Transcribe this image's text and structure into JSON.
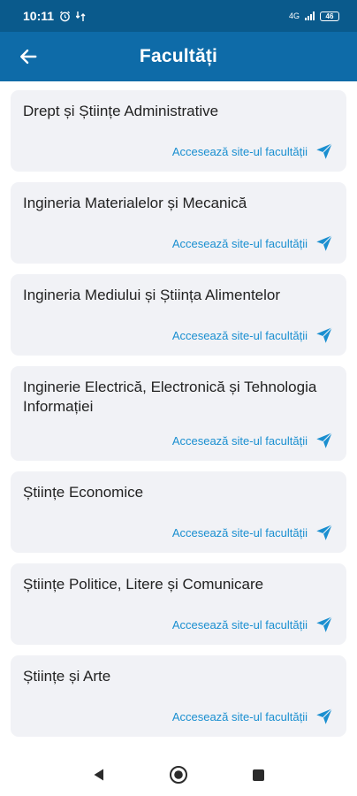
{
  "status_bar": {
    "time": "10:11",
    "network": "4G",
    "battery": "46"
  },
  "app_bar": {
    "title": "Facultăți"
  },
  "faculties": [
    {
      "name": "Drept și Științe Administrative",
      "link_label": "Accesează site-ul facultății"
    },
    {
      "name": "Ingineria Materialelor și Mecanică",
      "link_label": "Accesează site-ul facultății"
    },
    {
      "name": "Ingineria Mediului și Știința Alimentelor",
      "link_label": "Accesează site-ul facultății"
    },
    {
      "name": "Inginerie Electrică, Electronică și Tehnologia Informației",
      "link_label": "Accesează site-ul facultății"
    },
    {
      "name": "Științe Economice",
      "link_label": "Accesează site-ul facultății"
    },
    {
      "name": "Științe Politice, Litere și Comunicare",
      "link_label": "Accesează site-ul facultății"
    },
    {
      "name": "Științe și Arte",
      "link_label": "Accesează site-ul facultății"
    }
  ],
  "colors": {
    "status_bar": "#0a5a8c",
    "app_bar": "#0e6ba8",
    "card_background": "#f1f2f6",
    "link": "#1a8fd0"
  },
  "icons": {
    "back": "arrow-left-icon",
    "link": "send-icon",
    "nav_back": "triangle-back-icon",
    "nav_home": "circle-home-icon",
    "nav_recents": "square-recents-icon"
  }
}
